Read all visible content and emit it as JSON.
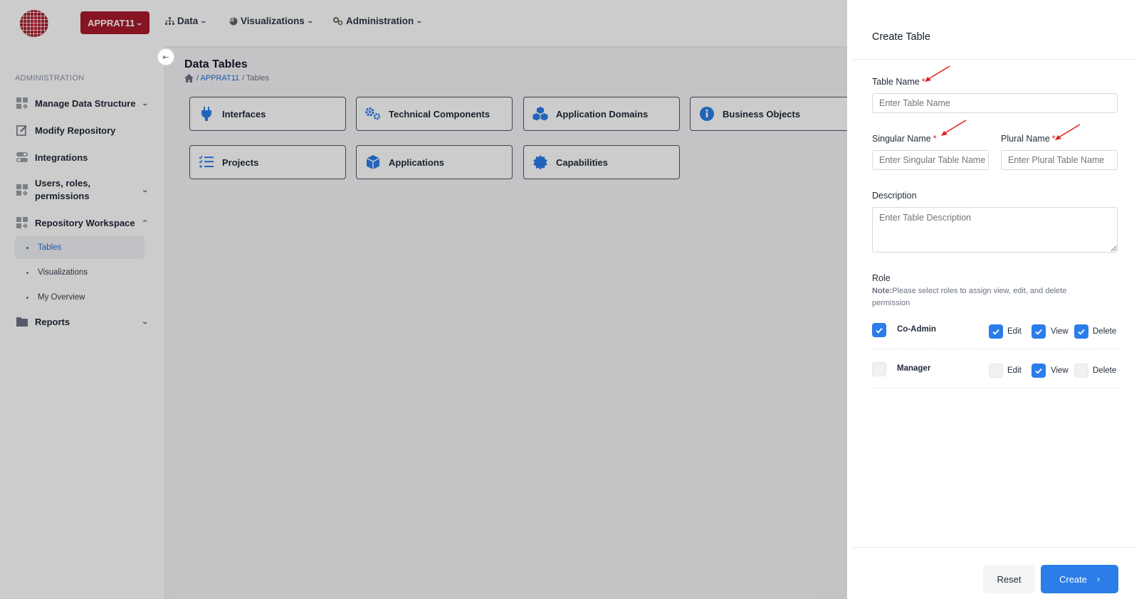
{
  "topbar": {
    "workspace_label": "APPRAT11",
    "nav": [
      {
        "label": "Data",
        "icon": "sitemap-icon"
      },
      {
        "label": "Visualizations",
        "icon": "pie-chart-icon"
      },
      {
        "label": "Administration",
        "icon": "gears-icon"
      }
    ]
  },
  "sidebar": {
    "section_label": "ADMINISTRATION",
    "items": [
      {
        "label": "Manage Data Structure",
        "icon": "grid-plus-icon"
      },
      {
        "label": "Modify Repository",
        "icon": "edit-icon"
      },
      {
        "label": "Integrations",
        "icon": "toggle-icon"
      },
      {
        "label": "Users, roles, permissions",
        "icon": "grid-plus-icon"
      },
      {
        "label": "Repository Workspace",
        "icon": "grid-plus-icon"
      },
      {
        "label": "Reports",
        "icon": "folder-icon"
      }
    ],
    "sub_items": [
      {
        "label": "Tables",
        "active": true
      },
      {
        "label": "Visualizations",
        "active": false
      },
      {
        "label": "My Overview",
        "active": false
      }
    ]
  },
  "main": {
    "title": "Data Tables",
    "breadcrumb": {
      "workspace": "/ APPRAT11",
      "current": "/ Tables"
    },
    "cards": [
      {
        "label": "Interfaces",
        "icon": "plug-icon"
      },
      {
        "label": "Technical Components",
        "icon": "cogs-icon"
      },
      {
        "label": "Application Domains",
        "icon": "cubes-icon"
      },
      {
        "label": "Business Objects",
        "icon": "info-circle-icon"
      },
      {
        "label": "Projects",
        "icon": "checklist-icon"
      },
      {
        "label": "Applications",
        "icon": "cube-icon"
      },
      {
        "label": "Capabilities",
        "icon": "certificate-icon"
      }
    ]
  },
  "drawer": {
    "title": "Create Table",
    "table_name": {
      "label": "Table Name",
      "required": "*",
      "placeholder": "Enter Table Name",
      "value": ""
    },
    "singular_name": {
      "label": "Singular Name",
      "required": "*",
      "placeholder": "Enter Singular Table Name",
      "value": ""
    },
    "plural_name": {
      "label": "Plural Name",
      "required": "*",
      "placeholder": "Enter Plural Table Name",
      "value": ""
    },
    "description": {
      "label": "Description",
      "placeholder": "Enter Table Description",
      "value": ""
    },
    "role": {
      "label": "Role",
      "note_prefix": "Note:",
      "note_text": "Please select roles to assign view, edit, and delete permission",
      "rows": [
        {
          "name": "Co-Admin",
          "selected": true,
          "edit": true,
          "view": true,
          "delete": true
        },
        {
          "name": "Manager",
          "selected": false,
          "edit": false,
          "view": true,
          "delete": false
        }
      ],
      "perm_labels": {
        "edit": "Edit",
        "view": "View",
        "delete": "Delete"
      }
    },
    "buttons": {
      "reset": "Reset",
      "create": "Create"
    }
  },
  "colors": {
    "brand": "#a8192c",
    "primary": "#2b7de9",
    "required": "#d81b2c",
    "annotation_arrow": "#e02020"
  }
}
